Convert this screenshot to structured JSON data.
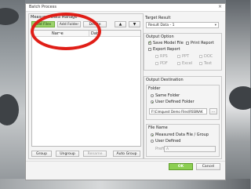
{
  "window": {
    "title": "Batch Process",
    "close_glyph": "×"
  },
  "measured_data_manage": {
    "title": "Measured Data Manage",
    "add_files": "Add Files",
    "add_folder": "Add Folder",
    "delete": "Delete",
    "up_glyph": "▲",
    "down_glyph": "▼",
    "columns": [
      "Name",
      "Date"
    ],
    "group": "Group",
    "ungroup": "Ungroup",
    "rename": "Rename",
    "auto_group": "Auto Group"
  },
  "target_result": {
    "title": "Target Result",
    "value": "Result Data - 1"
  },
  "output_option": {
    "title": "Output Option",
    "save_model_file": "Save Model File",
    "print_report": "Print Report",
    "export_report": "Export Report",
    "formats": [
      "RPS",
      "PPT",
      "DOC",
      "PDF",
      "Excel",
      "Text"
    ]
  },
  "output_destination": {
    "title": "Output Destination",
    "folder": {
      "title": "Folder",
      "same_folder": "Same Folder",
      "user_defined_folder": "User Defined Folder",
      "path": "F:\\Cimquest Demo Files\\RSSINAK",
      "browse": "..."
    },
    "file_name": {
      "title": "File Name",
      "measured_data_file_group": "Measured Data File / Group",
      "user_defined": "User Defined",
      "prefix_label": "Prefix",
      "prefix_value": "A"
    }
  },
  "footer": {
    "ok": "OK",
    "cancel": "Cancel"
  },
  "colors": {
    "highlight_ring": "#e01e17",
    "ok_button": "#8ccf52",
    "add_files_button": "#9cd36c"
  }
}
